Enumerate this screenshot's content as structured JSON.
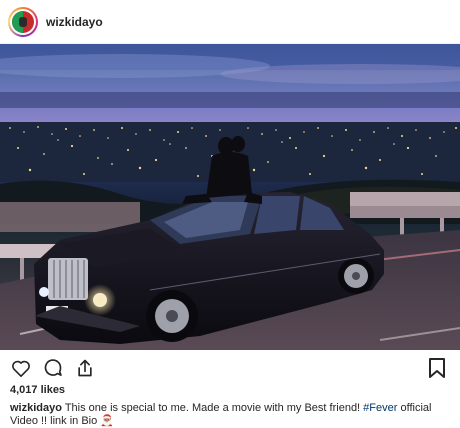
{
  "post": {
    "username": "wizkidayo",
    "likes": "4,017 likes",
    "caption": {
      "username": "wizkidayo",
      "text_before": " This one is special to me. Made a movie with my Best friend! ",
      "hashtag": "#Fever",
      "text_after": " official Video !! link in Bio 🎅🏽"
    }
  },
  "icons": {
    "like": "heart-icon",
    "comment": "comment-icon",
    "share": "share-icon",
    "save": "bookmark-icon",
    "avatar": "profile-avatar"
  },
  "colors": {
    "text": "#262626",
    "hashtag": "#00376b",
    "divider": "#efefef"
  }
}
